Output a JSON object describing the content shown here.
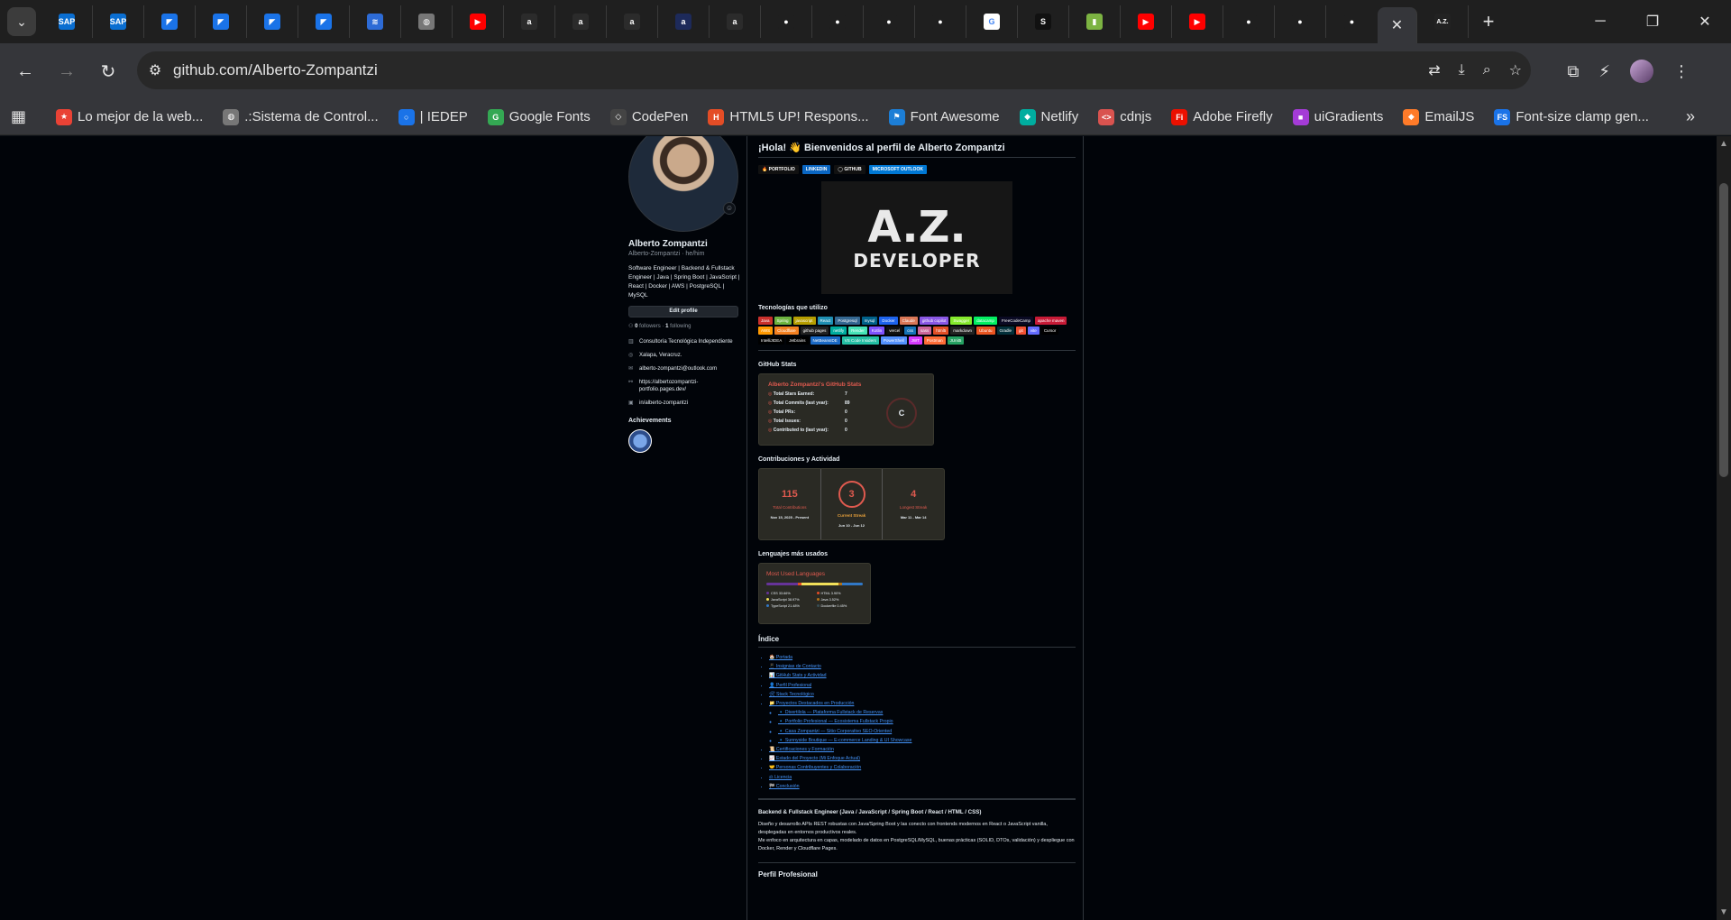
{
  "browser": {
    "tabs": [
      {
        "icon": "sap-icon",
        "glyph": "SAP",
        "color": "#0a6ed1"
      },
      {
        "icon": "sap-icon",
        "glyph": "SAP",
        "color": "#0a6ed1"
      },
      {
        "icon": "flag-blue-icon",
        "glyph": "◤",
        "color": "#1a73e8"
      },
      {
        "icon": "flag-blue-icon",
        "glyph": "◤",
        "color": "#1a73e8"
      },
      {
        "icon": "flag-blue-icon",
        "glyph": "◤",
        "color": "#1a73e8"
      },
      {
        "icon": "flag-blue-icon",
        "glyph": "◤",
        "color": "#1a73e8"
      },
      {
        "icon": "stack-icon",
        "glyph": "≋",
        "color": "#2d6bd6"
      },
      {
        "icon": "globe-icon",
        "glyph": "◍",
        "color": "#777777"
      },
      {
        "icon": "youtube-icon",
        "glyph": "▶",
        "color": "#ff0000"
      },
      {
        "icon": "a-icon",
        "glyph": "a",
        "color": "#2b2b2b"
      },
      {
        "icon": "a-icon",
        "glyph": "a",
        "color": "#2b2b2b"
      },
      {
        "icon": "a-icon",
        "glyph": "a",
        "color": "#2b2b2b"
      },
      {
        "icon": "a-icon",
        "glyph": "a",
        "color": "#1d2a5a"
      },
      {
        "icon": "a-icon",
        "glyph": "a",
        "color": "#2b2b2b"
      },
      {
        "icon": "github-icon",
        "glyph": "●",
        "color": "#1f1f1f"
      },
      {
        "icon": "github-icon",
        "glyph": "●",
        "color": "#1f1f1f"
      },
      {
        "icon": "github-icon",
        "glyph": "●",
        "color": "#1f1f1f"
      },
      {
        "icon": "github-icon",
        "glyph": "●",
        "color": "#1f1f1f"
      },
      {
        "icon": "google-icon",
        "glyph": "G",
        "color": "#ffffff"
      },
      {
        "icon": "s-icon",
        "glyph": "S",
        "color": "#111111"
      },
      {
        "icon": "green-square-icon",
        "glyph": "▮",
        "color": "#7cb342"
      },
      {
        "icon": "youtube-icon",
        "glyph": "▶",
        "color": "#ff0000"
      },
      {
        "icon": "youtube-icon",
        "glyph": "▶",
        "color": "#ff0000"
      },
      {
        "icon": "github-icon",
        "glyph": "●",
        "color": "#1f1f1f"
      },
      {
        "icon": "github-icon",
        "glyph": "●",
        "color": "#1f1f1f"
      },
      {
        "icon": "github-icon",
        "glyph": "●",
        "color": "#1f1f1f"
      }
    ],
    "active_tab_close": "✕",
    "last_tab_glyph": "A.Z.",
    "new_tab": "+",
    "url": "github.com/Alberto-Zompantzi",
    "bookmarks": [
      {
        "label": "Lo mejor de la web...",
        "color": "#e94235",
        "glyph": "★"
      },
      {
        "label": ".:Sistema de Control...",
        "color": "#777777",
        "glyph": "◍"
      },
      {
        "label": "| IEDEP",
        "color": "#1a73e8",
        "glyph": "○"
      },
      {
        "label": "Google Fonts",
        "color": "#34a853",
        "glyph": "G"
      },
      {
        "label": "CodePen",
        "color": "#444444",
        "glyph": "◇"
      },
      {
        "label": "HTML5 UP! Respons...",
        "color": "#e44d26",
        "glyph": "H"
      },
      {
        "label": "Font Awesome",
        "color": "#1c7ed6",
        "glyph": "⚑"
      },
      {
        "label": "Netlify",
        "color": "#00ad9f",
        "glyph": "◆"
      },
      {
        "label": "cdnjs",
        "color": "#d9534f",
        "glyph": "<>"
      },
      {
        "label": "Adobe Firefly",
        "color": "#eb1000",
        "glyph": "Fi"
      },
      {
        "label": "uiGradients",
        "color": "#a43bd6",
        "glyph": "■"
      },
      {
        "label": "EmailJS",
        "color": "#ff7b29",
        "glyph": "◆"
      },
      {
        "label": "Font-size clamp gen...",
        "color": "#1a73e8",
        "glyph": "FS"
      }
    ]
  },
  "profile": {
    "name": "Alberto Zompantzi",
    "username": "Alberto-Zompantzi · he/him",
    "bio": "Software Engineer | Backend & Fullstack Engineer | Java | Spring Boot | JavaScript | React | Docker | AWS | PostgreSQL | MySQL",
    "edit_button": "Edit profile",
    "followers_count": "0",
    "followers_label": "followers",
    "following_count": "1",
    "following_label": "following",
    "details": [
      {
        "icon": "building-icon",
        "glyph": "▥",
        "text": "Consultoría Tecnológica Independiente"
      },
      {
        "icon": "location-icon",
        "glyph": "◎",
        "text": "Xalapa, Veracruz."
      },
      {
        "icon": "mail-icon",
        "glyph": "✉",
        "text": "alberto-zompantzi@outlook.com"
      },
      {
        "icon": "link-icon",
        "glyph": "⚯",
        "text": "https://albertozompantzi-portfolio.pages.dev/"
      },
      {
        "icon": "linkedin-icon",
        "glyph": "▣",
        "text": "in/alberto-zompantzi"
      }
    ],
    "achievements_title": "Achievements"
  },
  "readme": {
    "title": "¡Hola! 👋 Bienvenidos al perfil de Alberto Zompantzi",
    "shields": [
      {
        "label": "🔥 PORTFOLIO",
        "color": "#111111"
      },
      {
        "label": "LINKEDIN",
        "color": "#0a66c2"
      },
      {
        "label": "◯ GITHUB",
        "color": "#111111"
      },
      {
        "label": "MICROSOFT OUTLOOK",
        "color": "#0078d4"
      }
    ],
    "banner_big": "A.Z.",
    "banner_sub": "DEVELOPER",
    "tech_title": "Tecnologías que utilizo",
    "techs": [
      {
        "label": "Java",
        "color": "#c9302c"
      },
      {
        "label": "Spring",
        "color": "#6db33f"
      },
      {
        "label": "javascript",
        "color": "#b59d00"
      },
      {
        "label": "React",
        "color": "#1f8fb3"
      },
      {
        "label": "Postgresql",
        "color": "#336791"
      },
      {
        "label": "mysql",
        "color": "#00618a"
      },
      {
        "label": "Docker",
        "color": "#1d63ed"
      },
      {
        "label": "Claude",
        "color": "#d97757"
      },
      {
        "label": "github copilot",
        "color": "#8957e5"
      },
      {
        "label": "Swagger",
        "color": "#85ea2d"
      },
      {
        "label": "datacamp",
        "color": "#03ef62"
      },
      {
        "label": "FreeCodeCamp",
        "color": "#0a0a23"
      },
      {
        "label": "apache maven",
        "color": "#c71a36"
      },
      {
        "label": "AWS",
        "color": "#ff9900"
      },
      {
        "label": "Cloudflare",
        "color": "#f38020"
      },
      {
        "label": "github pages",
        "color": "#222222"
      },
      {
        "label": "netlify",
        "color": "#00ad9f"
      },
      {
        "label": "Render",
        "color": "#46e3b7"
      },
      {
        "label": "Kotlin",
        "color": "#7f52ff"
      },
      {
        "label": "vercel",
        "color": "#111111"
      },
      {
        "label": "css",
        "color": "#1572b6"
      },
      {
        "label": "sass",
        "color": "#cc6699"
      },
      {
        "label": "html5",
        "color": "#e34f26"
      },
      {
        "label": "markdown",
        "color": "#222222"
      },
      {
        "label": "Ubuntu",
        "color": "#e95420"
      },
      {
        "label": "Gradle",
        "color": "#02303a"
      },
      {
        "label": "git",
        "color": "#f05032"
      },
      {
        "label": "vite",
        "color": "#646cff"
      },
      {
        "label": "Cursor",
        "color": "#000000"
      },
      {
        "label": "IntelliJIDEA",
        "color": "#000000"
      },
      {
        "label": "Jetbrains",
        "color": "#000000"
      },
      {
        "label": "NetBeansIDE",
        "color": "#1b6ac6"
      },
      {
        "label": "VS Code Insiders",
        "color": "#24bfa5"
      },
      {
        "label": "PowerShell",
        "color": "#5391fe"
      },
      {
        "label": "JWT",
        "color": "#d63aff"
      },
      {
        "label": "Postman",
        "color": "#ff6c37"
      },
      {
        "label": "JUnit5",
        "color": "#25a162"
      }
    ],
    "stats_section": "GitHub Stats",
    "stats_card_title": "Alberto Zompantzi's GitHub Stats",
    "stats": [
      {
        "label": "Total Stars Earned:",
        "value": "7"
      },
      {
        "label": "Total Commits (last year):",
        "value": "89"
      },
      {
        "label": "Total PRs:",
        "value": "0"
      },
      {
        "label": "Total Issues:",
        "value": "0"
      },
      {
        "label": "Contributed to (last year):",
        "value": "0"
      }
    ],
    "stats_grade": "C",
    "activity_section": "Contribuciones y Actividad",
    "streak": [
      {
        "num": "115",
        "label": "Total Contributions",
        "date": "Nov 15, 2025 - Present"
      },
      {
        "num": "3",
        "label": "Current Streak",
        "date": "Jun 10 - Jun 12"
      },
      {
        "num": "4",
        "label": "Longest Streak",
        "date": "Mar 11 - Mar 14"
      }
    ],
    "langs_section": "Lenguajes más usados",
    "langs_card_title": "Most Used Languages",
    "languages": [
      {
        "name": "CSS 33.66%",
        "color": "#663399",
        "pct": 33.66
      },
      {
        "name": "HTML 3.90%",
        "color": "#e34c26",
        "pct": 3.9
      },
      {
        "name": "JavaScript 38.97%",
        "color": "#f1e05a",
        "pct": 38.97
      },
      {
        "name": "Java 3.52%",
        "color": "#b07219",
        "pct": 3.52
      },
      {
        "name": "TypeScript 21.48%",
        "color": "#3178c6",
        "pct": 21.48
      },
      {
        "name": "Dockerfile 0.45%",
        "color": "#384d54",
        "pct": 0.45
      }
    ],
    "index_title": "Índice",
    "toc": [
      "🏠 Portada",
      "📱 Insignias de Contacto",
      "📊 GitHub Stats y Actividad",
      "👤 Perfil Profesional",
      "🛠 Stack Tecnológico",
      "📁 Proyectos Destacados en Producción"
    ],
    "toc_sub": [
      "🔹 Divertilola — Plataforma Fullstack de Reservas",
      "🔹 Portfolio Profesional — Ecosistema Fullstack Propio",
      "🔹 Casa Zompantzi — Sitio Corporativo SEO-Oriented",
      "🔹 Sunnyside Boutique — E-commerce Landing & UI Showcase"
    ],
    "toc_after": [
      "📜 Certificaciones y Formación",
      "📈 Estado del Proyecto (Mi Enfoque Actual)",
      "🤝 Personas Contribuyentes y Colaboración",
      "⚖ Licencia",
      "🏁 Conclusión"
    ],
    "profile_heading": "Backend & Fullstack Engineer (Java / JavaScript / Spring Boot / React / HTML / CSS)",
    "para1": "Diseño y desarrollo APIs REST robustas con Java/Spring Boot y las conecto con frontends modernos en React o JavaScript vanilla, desplegadas en entornos productivos reales.",
    "para2": "Me enfoco en arquitectura en capas, modelado de datos en PostgreSQL/MySQL, buenas prácticas (SOLID, DTOs, validación) y despliegue con Docker, Render y Cloudflare Pages.",
    "next_section": "Perfil Profesional"
  }
}
